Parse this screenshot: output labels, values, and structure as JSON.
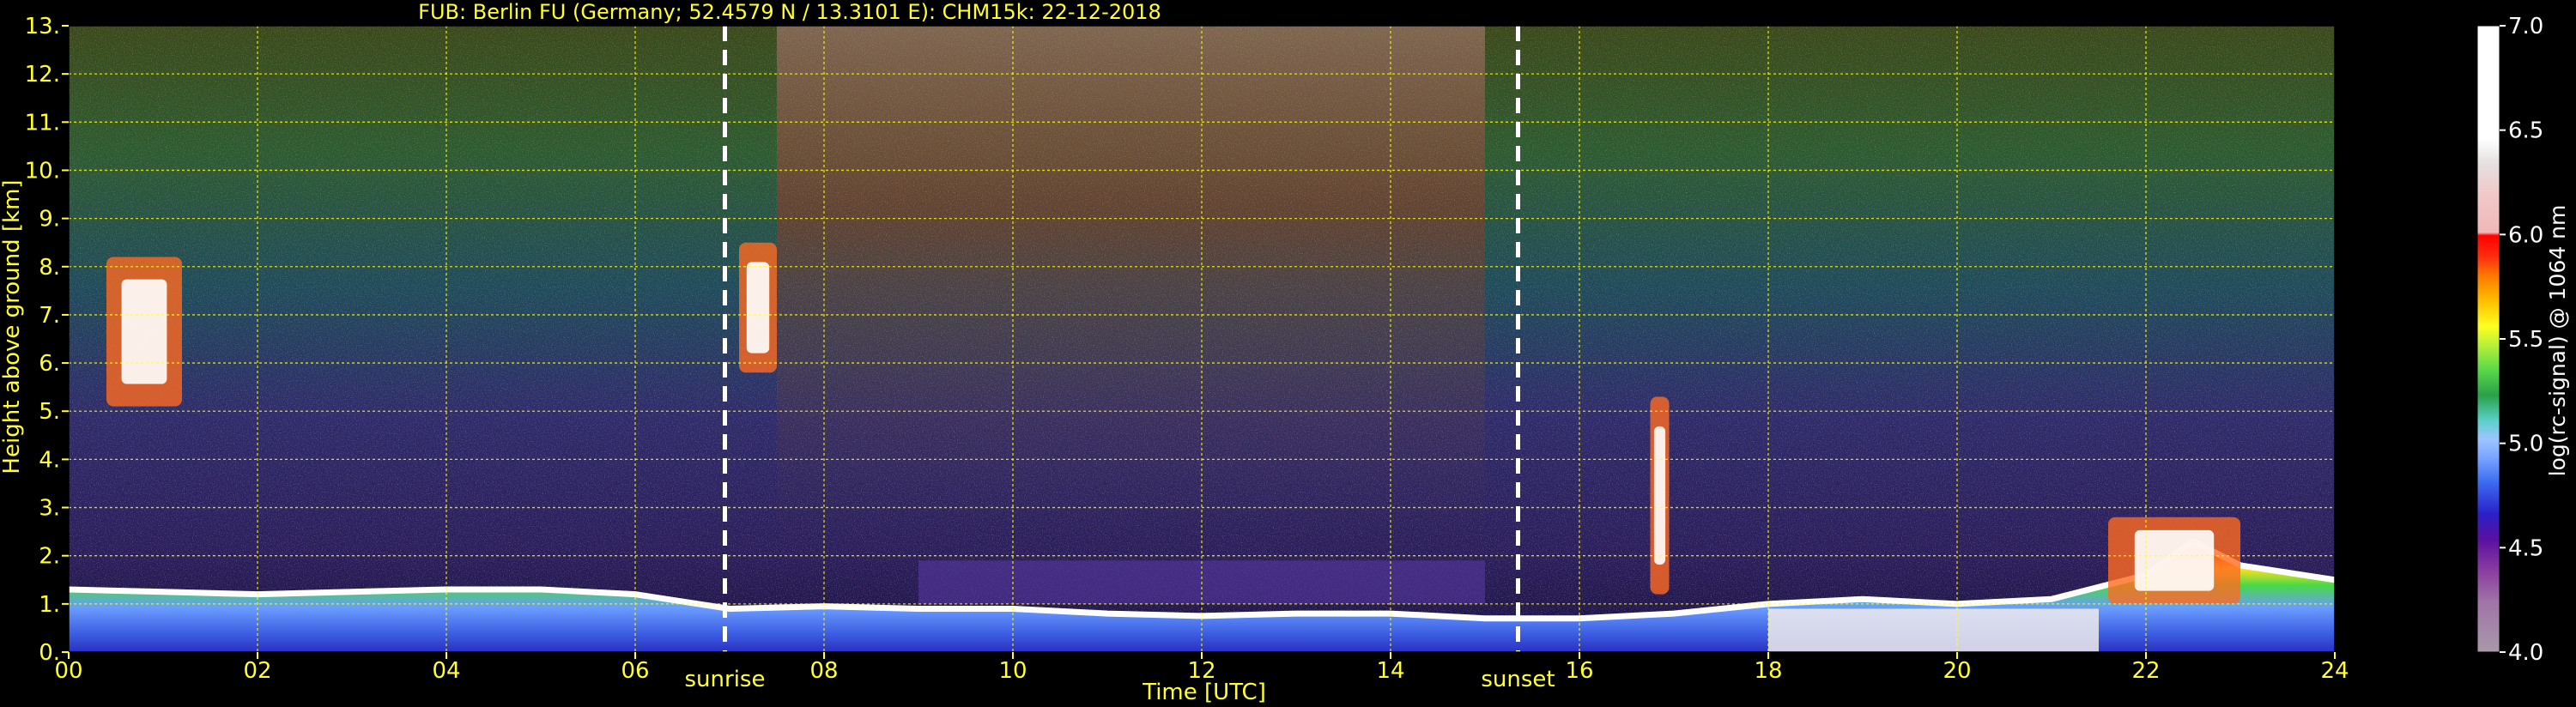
{
  "chart_data": {
    "type": "heatmap",
    "title": "FUB: Berlin FU (Germany; 52.4579 N / 13.3101 E):    CHM15k: 22-12-2018",
    "xlabel": "Time [UTC]",
    "ylabel": "Height above ground [km]",
    "colorbar_label": "log(rc-signal) @ 1064 nm",
    "xlim": [
      0,
      24
    ],
    "ylim": [
      0,
      13
    ],
    "clim": [
      4.0,
      7.0
    ],
    "grid": true,
    "x_ticks": [
      "00",
      "02",
      "04",
      "06",
      "08",
      "10",
      "12",
      "14",
      "16",
      "18",
      "20",
      "22",
      "24"
    ],
    "y_ticks": [
      "0.",
      "1.",
      "2.",
      "3.",
      "4.",
      "5.",
      "6.",
      "7.",
      "8.",
      "9.",
      "10.",
      "11.",
      "12.",
      "13."
    ],
    "colorbar_ticks": [
      "4.0",
      "4.5",
      "5.0",
      "5.5",
      "6.0",
      "6.5",
      "7.0"
    ],
    "markers": [
      {
        "label": "sunrise",
        "x": 6.95
      },
      {
        "label": "sunset",
        "x": 15.35
      }
    ],
    "boundary_layer_top_km": [
      [
        0.0,
        1.3
      ],
      [
        1.0,
        1.25
      ],
      [
        2.0,
        1.2
      ],
      [
        3.0,
        1.25
      ],
      [
        4.0,
        1.3
      ],
      [
        5.0,
        1.3
      ],
      [
        6.0,
        1.2
      ],
      [
        7.0,
        0.9
      ],
      [
        8.0,
        0.95
      ],
      [
        9.0,
        0.9
      ],
      [
        10.0,
        0.9
      ],
      [
        11.0,
        0.8
      ],
      [
        12.0,
        0.75
      ],
      [
        13.0,
        0.8
      ],
      [
        14.0,
        0.8
      ],
      [
        15.0,
        0.7
      ],
      [
        16.0,
        0.7
      ],
      [
        17.0,
        0.8
      ],
      [
        18.0,
        1.0
      ],
      [
        19.0,
        1.1
      ],
      [
        20.0,
        1.0
      ],
      [
        21.0,
        1.1
      ],
      [
        22.0,
        1.6
      ],
      [
        22.5,
        2.3
      ],
      [
        23.0,
        1.8
      ],
      [
        24.0,
        1.5
      ]
    ],
    "cloud_features": [
      {
        "x0": 0.4,
        "x1": 1.2,
        "y0": 5.1,
        "y1": 8.2
      },
      {
        "x0": 7.1,
        "x1": 7.5,
        "y0": 5.8,
        "y1": 8.5
      },
      {
        "x0": 16.75,
        "x1": 16.95,
        "y0": 1.2,
        "y1": 5.3
      },
      {
        "x0": 21.6,
        "x1": 23.0,
        "y0": 1.0,
        "y1": 2.8
      }
    ],
    "colors": {
      "label": "#ffff33",
      "grid": "#ffff33",
      "marker_line": "#ffffff",
      "colormap": [
        "#a89aa8",
        "#a074a8",
        "#8a3ca0",
        "#5a10a0",
        "#2a20c8",
        "#3a6af0",
        "#7aa4ff",
        "#9ec4ff",
        "#5ad0c8",
        "#2aa048",
        "#58d848",
        "#b8f038",
        "#ffff20",
        "#ffc000",
        "#ff7a00",
        "#ff3010",
        "#ff0000",
        "#f0b8b8",
        "#e6e0e0",
        "#ffffff"
      ]
    }
  }
}
